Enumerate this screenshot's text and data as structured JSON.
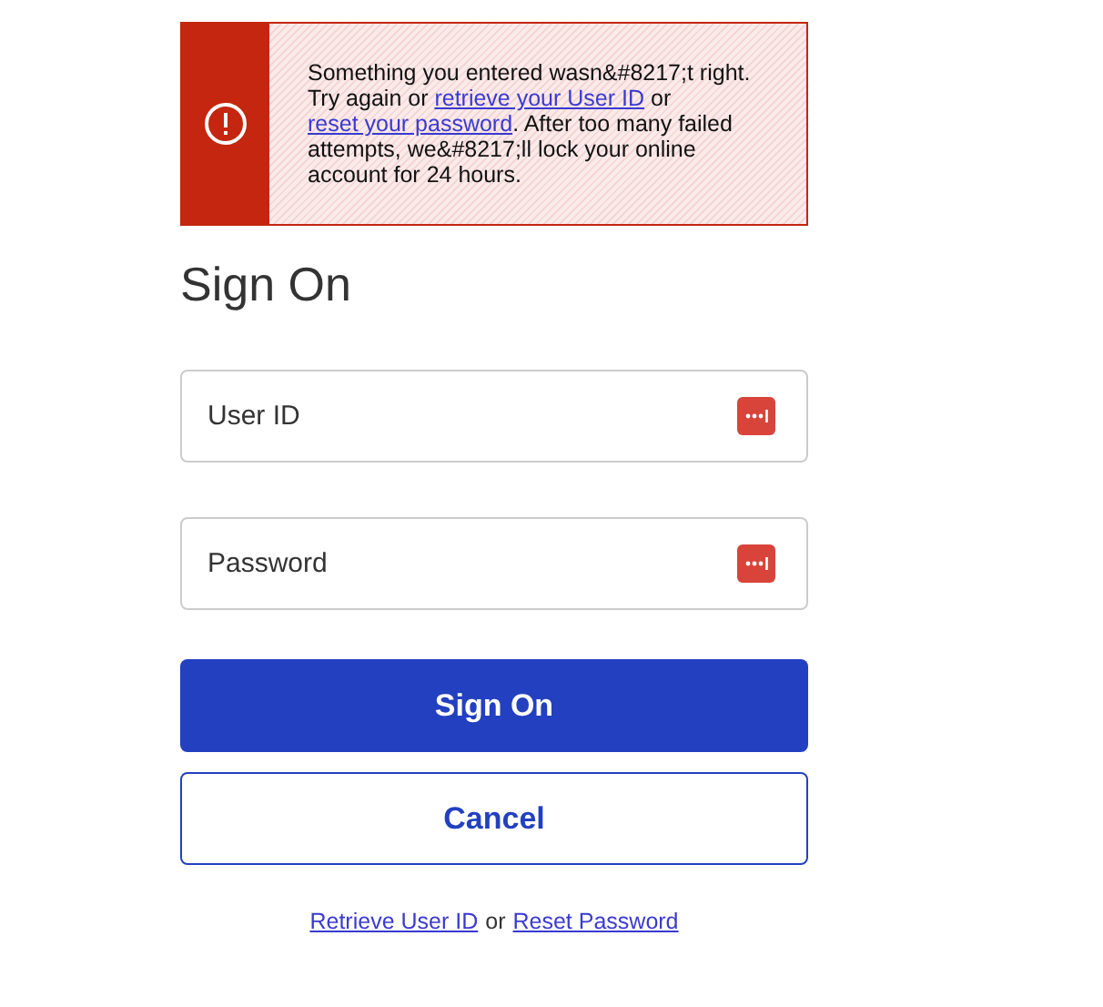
{
  "alert": {
    "message": [
      {
        "kind": "text",
        "text": "Something you entered wasn&#8217;t right. Try again or "
      },
      {
        "kind": "link",
        "text": "retrieve your User ID"
      },
      {
        "kind": "text",
        "text": " or "
      },
      {
        "kind": "link",
        "text": "reset your password"
      },
      {
        "kind": "text",
        "text": ". After too many failed attempts, we&#8217;ll lock your online account for 24 hours."
      }
    ]
  },
  "title": "Sign On",
  "fields": [
    {
      "placeholder": "User ID"
    },
    {
      "placeholder": "Password"
    }
  ],
  "buttons": [
    {
      "label": "Sign On",
      "kind": "primary"
    },
    {
      "label": "Cancel",
      "kind": "secondary"
    }
  ],
  "footer": [
    {
      "kind": "link",
      "text": "Retrieve User ID"
    },
    {
      "kind": "text",
      "text": "or"
    },
    {
      "kind": "link",
      "text": "Reset Password"
    }
  ]
}
